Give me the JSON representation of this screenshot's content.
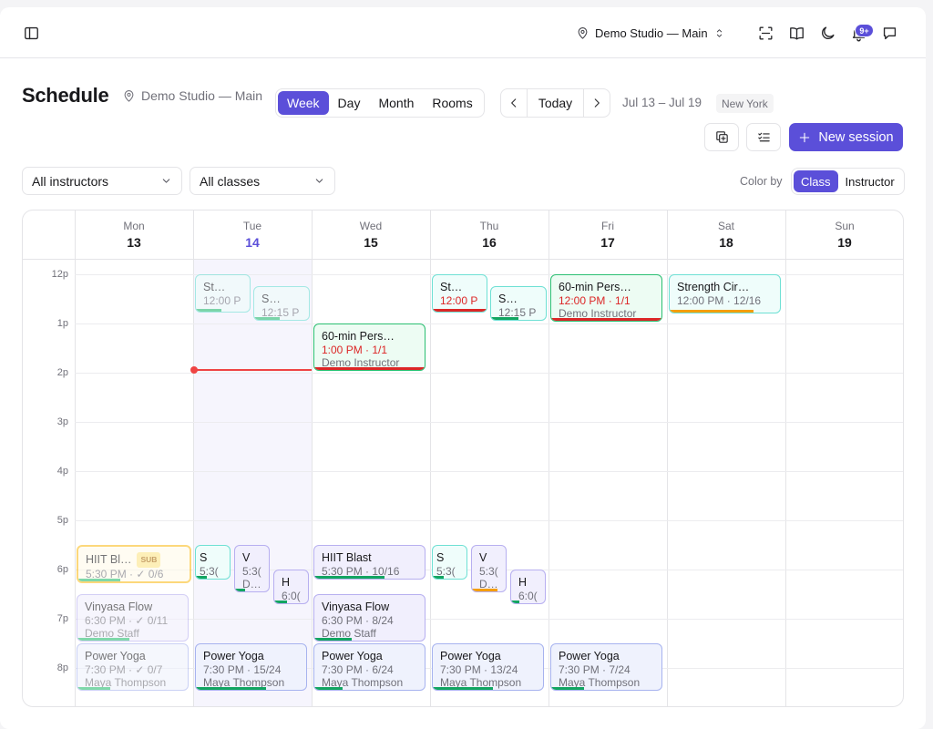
{
  "topbar": {
    "studio": "Demo Studio — Main",
    "notifications": "9+",
    "icons": [
      "sidebar-toggle-icon",
      "location-pin-icon",
      "chevron-updown-icon",
      "scan-icon",
      "book-icon",
      "moon-icon",
      "bell-icon",
      "chat-icon"
    ]
  },
  "header": {
    "title": "Schedule",
    "location": "Demo Studio — Main",
    "views": [
      "Week",
      "Day",
      "Month",
      "Rooms"
    ],
    "active_view": "Week",
    "today_label": "Today",
    "range": "Jul 13 – Jul 19",
    "timezone": "New York"
  },
  "toolbar": {
    "new_session": "New session"
  },
  "filters": {
    "instructors": "All instructors",
    "classes": "All classes",
    "color_by_label": "Color by",
    "color_by_options": [
      "Class",
      "Instructor"
    ],
    "color_by_active": "Class"
  },
  "calendar": {
    "days": [
      {
        "name": "Mon",
        "date": "13"
      },
      {
        "name": "Tue",
        "date": "14",
        "today": true
      },
      {
        "name": "Wed",
        "date": "15"
      },
      {
        "name": "Thu",
        "date": "16"
      },
      {
        "name": "Fri",
        "date": "17"
      },
      {
        "name": "Sat",
        "date": "18"
      },
      {
        "name": "Sun",
        "date": "19"
      }
    ],
    "hours": [
      "12p",
      "1p",
      "2p",
      "3p",
      "4p",
      "5p",
      "6p",
      "7p",
      "8p"
    ],
    "events": [
      {
        "title": "St…",
        "meta": "12:00 P",
        "day": "Tue"
      },
      {
        "title": "S…",
        "meta": "12:15 P",
        "day": "Tue"
      },
      {
        "title": "St…",
        "meta": "12:00 P",
        "day": "Thu"
      },
      {
        "title": "S…",
        "meta": "12:15 P",
        "day": "Thu"
      },
      {
        "title": "60-min Pers…",
        "meta": "1:00 PM · 1/1",
        "sub": "Demo Instructor",
        "day": "Wed"
      },
      {
        "title": "60-min Pers…",
        "meta": "12:00 PM · 1/1",
        "sub": "Demo Instructor",
        "day": "Fri"
      },
      {
        "title": "Strength Cir…",
        "meta": "12:00 PM · 12/16",
        "day": "Sat"
      },
      {
        "title": "HIIT Bl…",
        "badge": "SUB",
        "meta": "5:30 PM · ✓ 0/6",
        "day": "Mon"
      },
      {
        "title": "Vinyasa Flow",
        "meta": "6:30 PM · ✓ 0/11",
        "sub": "Demo Staff",
        "day": "Mon"
      },
      {
        "title": "Power Yoga",
        "meta": "7:30 PM · ✓ 0/7",
        "sub": "Maya Thompson",
        "day": "Mon"
      },
      {
        "title": "S",
        "meta": "5:3(",
        "day": "Tue"
      },
      {
        "title": "V",
        "meta": "5:3(",
        "sub": "D…",
        "day": "Tue"
      },
      {
        "title": "H",
        "meta": "6:0(",
        "day": "Tue"
      },
      {
        "title": "Power Yoga",
        "meta": "7:30 PM · 15/24",
        "sub": "Maya Thompson",
        "day": "Tue"
      },
      {
        "title": "HIIT Blast",
        "meta": "5:30 PM · 10/16",
        "day": "Wed"
      },
      {
        "title": "Vinyasa Flow",
        "meta": "6:30 PM · 8/24",
        "sub": "Demo Staff",
        "day": "Wed"
      },
      {
        "title": "Power Yoga",
        "meta": "7:30 PM · 6/24",
        "sub": "Maya Thompson",
        "day": "Wed"
      },
      {
        "title": "S",
        "meta": "5:3(",
        "day": "Thu"
      },
      {
        "title": "V",
        "meta": "5:3(",
        "sub": "D…",
        "day": "Thu"
      },
      {
        "title": "H",
        "meta": "6:0(",
        "day": "Thu"
      },
      {
        "title": "Power Yoga",
        "meta": "7:30 PM · 13/24",
        "sub": "Maya Thompson",
        "day": "Thu"
      },
      {
        "title": "Power Yoga",
        "meta": "7:30 PM · 7/24",
        "sub": "Maya Thompson",
        "day": "Fri"
      }
    ]
  },
  "colors": {
    "accent": "#5b4fd9",
    "now_line": "#ef4444",
    "teal": "#6ee0d4",
    "green": "#2bbf72",
    "red": "#dc2626",
    "amber": "#fbbf24"
  }
}
